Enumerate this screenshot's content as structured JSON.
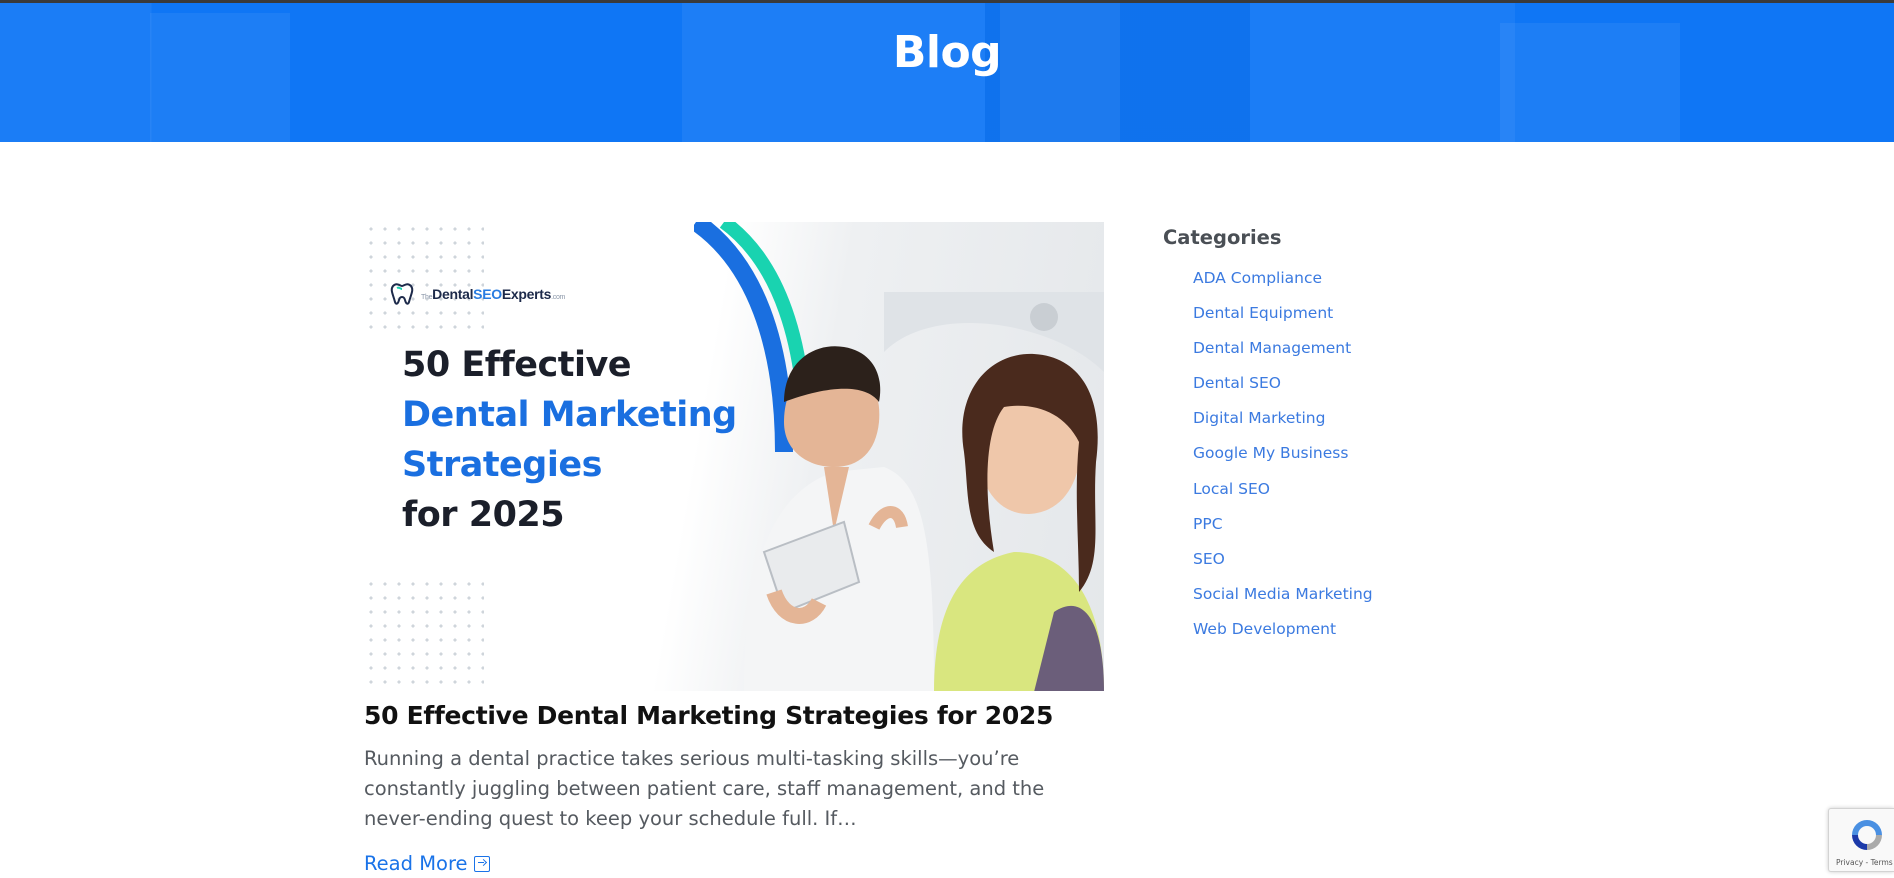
{
  "header": {
    "title": "Blog"
  },
  "post": {
    "image": {
      "brand_prefix": "The",
      "brand_main": "Dental",
      "brand_seo": "SEO",
      "brand_tail": "Experts",
      "brand_suffix": ".com",
      "headline_line1": "50 Effective",
      "headline_line2": "Dental Marketing",
      "headline_line3": "Strategies",
      "headline_line4": "for 2025"
    },
    "title": "50 Effective Dental Marketing Strategies for 2025",
    "excerpt": "Running a dental practice takes serious multi-tasking skills—you’re constantly juggling between patient care, staff management, and the never-ending quest to keep your schedule full. If…",
    "read_more": "Read More"
  },
  "sidebar": {
    "heading": "Categories",
    "items": [
      "ADA Compliance",
      "Dental Equipment",
      "Dental Management",
      "Dental SEO",
      "Digital Marketing",
      "Google My Business",
      "Local SEO",
      "PPC",
      "SEO",
      "Social Media Marketing",
      "Web Development"
    ]
  },
  "recaptcha": {
    "legal": "Privacy - Terms"
  },
  "colors": {
    "hero": "#0f76f5",
    "link": "#3b7ae0",
    "accent_blue": "#1a6fe0",
    "accent_teal": "#19d3b0"
  }
}
